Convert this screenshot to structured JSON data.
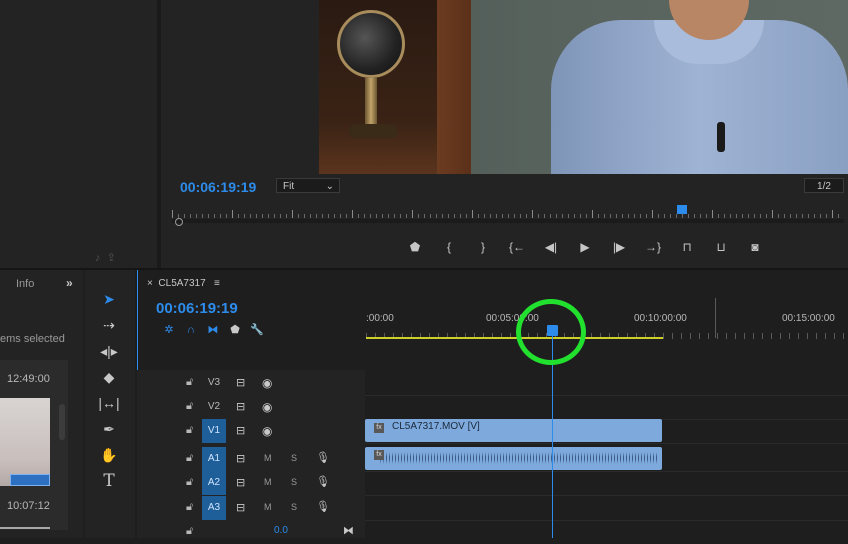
{
  "program_monitor": {
    "timecode": "00:06:19:19",
    "zoom": "Fit",
    "resolution": "1/2",
    "transport_icons": [
      "add-marker-icon",
      "mark-in-icon",
      "mark-out-icon",
      "go-to-in-icon",
      "step-back-icon",
      "play-icon",
      "step-forward-icon",
      "go-to-out-icon",
      "lift-icon",
      "extract-icon",
      "export-frame-icon"
    ]
  },
  "left_panel": {
    "tab_info": "Info",
    "more": "»",
    "items_selected": "ems selected",
    "thumb_time_1": "12:49:00",
    "thumb_time_2": "10:07:12"
  },
  "tools": [
    "selection-tool-icon",
    "track-select-tool-icon",
    "ripple-edit-tool-icon",
    "razor-tool-icon",
    "slip-tool-icon",
    "pen-tool-icon",
    "hand-tool-icon",
    "type-tool-icon"
  ],
  "timeline": {
    "close": "×",
    "sequence_name": "CL5A7317",
    "menu": "≡",
    "timecode": "00:06:19:19",
    "ruler_labels": [
      ":00:00",
      "00:05:00:00",
      "00:10:00:00",
      "00:15:00:00"
    ],
    "tracks": {
      "v3": {
        "label": "V3"
      },
      "v2": {
        "label": "V2"
      },
      "v1": {
        "label": "V1"
      },
      "a1": {
        "label": "A1",
        "m": "M",
        "s": "S"
      },
      "a2": {
        "label": "A2",
        "m": "M",
        "s": "S"
      },
      "a3": {
        "label": "A3",
        "m": "M",
        "s": "S"
      },
      "master": {
        "volume": "0.0"
      }
    },
    "clip_video_name": "CL5A7317.MOV [V]",
    "fx_label": "fx"
  },
  "colors": {
    "accent": "#2d8ceb",
    "clip": "#7ea9dc",
    "highlight": "#22e02e",
    "workarea": "#cfcf2a"
  }
}
